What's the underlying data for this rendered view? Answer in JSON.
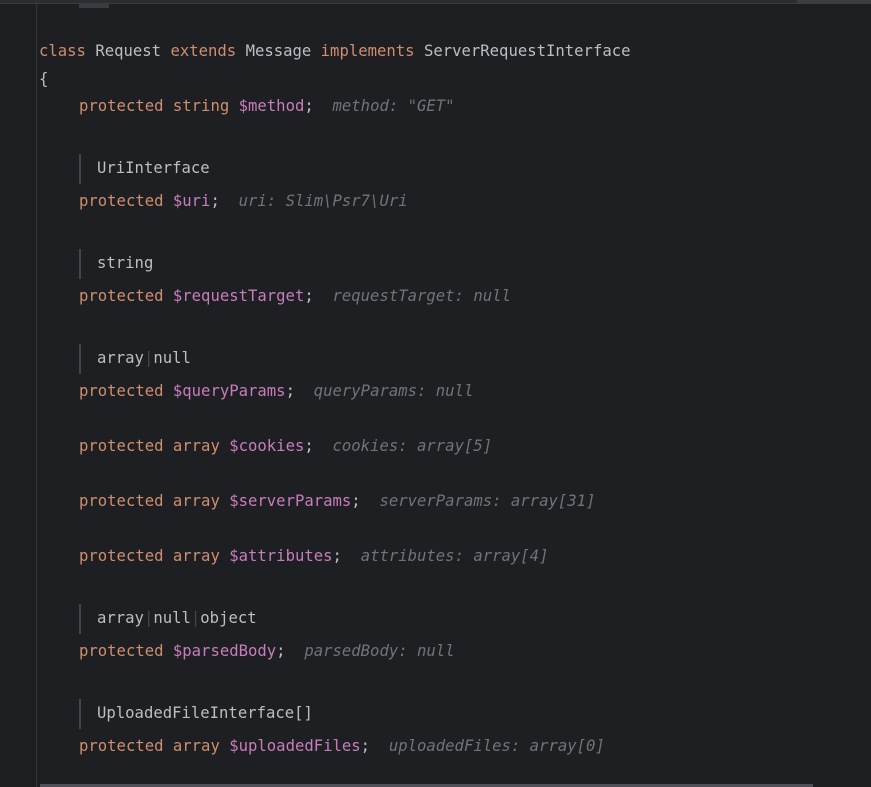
{
  "code": {
    "class_decl": {
      "kw_class": "class",
      "class_name": "Request",
      "kw_extends": "extends",
      "parent": "Message",
      "kw_implements": "implements",
      "interface": "ServerRequestInterface"
    },
    "open_brace": "{",
    "properties": [
      {
        "doc": null,
        "mods": "protected",
        "type": "string",
        "var": "$method",
        "semi": ";",
        "hint": "method: \"GET\""
      },
      {
        "doc": [
          "UriInterface"
        ],
        "mods": "protected",
        "type": null,
        "var": "$uri",
        "semi": ";",
        "hint": "uri: Slim\\Psr7\\Uri"
      },
      {
        "doc": [
          "string"
        ],
        "mods": "protected",
        "type": null,
        "var": "$requestTarget",
        "semi": ";",
        "hint": "requestTarget: null"
      },
      {
        "doc": [
          "array",
          "null"
        ],
        "mods": "protected",
        "type": null,
        "var": "$queryParams",
        "semi": ";",
        "hint": "queryParams: null"
      },
      {
        "doc": null,
        "mods": "protected",
        "type": "array",
        "var": "$cookies",
        "semi": ";",
        "hint": "cookies: array[5]"
      },
      {
        "doc": null,
        "mods": "protected",
        "type": "array",
        "var": "$serverParams",
        "semi": ";",
        "hint": "serverParams: array[31]"
      },
      {
        "doc": null,
        "mods": "protected",
        "type": "array",
        "var": "$attributes",
        "semi": ";",
        "hint": "attributes: array[4]"
      },
      {
        "doc": [
          "array",
          "null",
          "object"
        ],
        "mods": "protected",
        "type": null,
        "var": "$parsedBody",
        "semi": ";",
        "hint": "parsedBody: null"
      },
      {
        "doc": [
          "UploadedFileInterface[]"
        ],
        "mods": "protected",
        "type": "array",
        "var": "$uploadedFiles",
        "semi": ";",
        "hint": "uploadedFiles: array[0]"
      }
    ],
    "doc_separator": "|"
  },
  "colors": {
    "background": "#1e1f22",
    "keyword": "#cf8e6d",
    "variable": "#c77dbb",
    "text": "#bcbec4",
    "inlay_hint": "#6f737a"
  }
}
